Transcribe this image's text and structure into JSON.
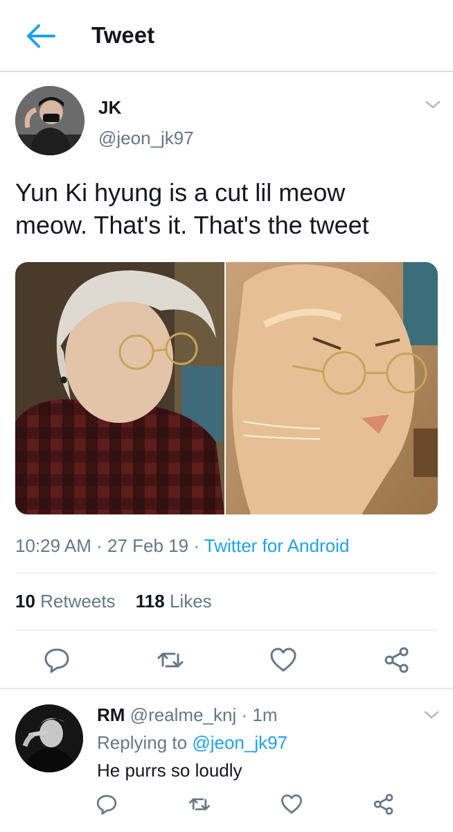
{
  "header": {
    "title": "Tweet",
    "back_icon": "arrow-left-icon",
    "accent": "#1da1f2"
  },
  "tweet": {
    "author_name": "JK",
    "author_handle": "@jeon_jk97",
    "text_line1": "Yun Ki hyung is a cut lil meow",
    "text_line2": "meow. That's it. That's the tweet",
    "time": "10:29 AM",
    "date": "27 Feb 19",
    "separator": "·",
    "source": "Twitter for Android",
    "retweet_count": "10",
    "retweet_label": "Retweets",
    "like_count": "118",
    "like_label": "Likes"
  },
  "reply": {
    "author_name": "RM",
    "author_handle": "@realme_knj",
    "age": "1m",
    "separator": "·",
    "replying_prefix": "Replying to",
    "replying_handle": "@jeon_jk97",
    "text": "He purrs so loudly"
  },
  "icons": [
    "arrow-left-icon",
    "chevron-down-icon",
    "reply-icon",
    "retweet-icon",
    "heart-icon",
    "share-icon"
  ]
}
